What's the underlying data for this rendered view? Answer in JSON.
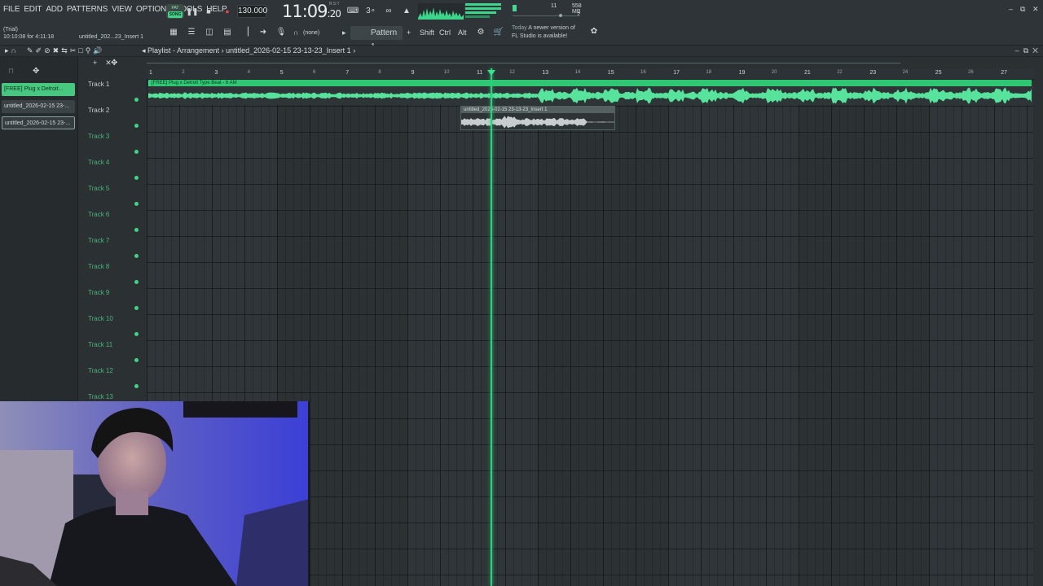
{
  "menu": [
    "FILE",
    "EDIT",
    "ADD",
    "PATTERNS",
    "VIEW",
    "OPTIONS",
    "TOOLS",
    "HELP"
  ],
  "status": {
    "trial": "(Trial)",
    "elapsed": "10:10:08 for 4:11:18",
    "project": "untitled_202...23_Insert 1"
  },
  "transport": {
    "mode": "SONG",
    "mode_top": "PAT",
    "bpm": "130.000",
    "time_main": "11:09",
    "time_sub": ":20",
    "time_label": "B:S:T"
  },
  "cpu": {
    "mem": "558 MB",
    "voices": "11",
    "poly": "2"
  },
  "toolbar": {
    "none_label": "(none)",
    "pattern": "Pattern 1",
    "shift": "Shift",
    "ctrl": "Ctrl",
    "alt": "Alt"
  },
  "news": {
    "line1": "A newer version of",
    "line2": "FL Studio is available!",
    "day": "Today"
  },
  "playlist": {
    "title": "Playlist - Arrangement",
    "breadcrumb": "untitled_2026-02-15 23-13-23_Insert 1"
  },
  "patterns": [
    "[FREE] Plug x Detroit...",
    "untitled_2026-02-15 23-...",
    "untitled_2026-02-15 23-..."
  ],
  "tracks": [
    "Track 1",
    "Track 2",
    "Track 3",
    "Track 4",
    "Track 5",
    "Track 6",
    "Track 7",
    "Track 8",
    "Track 9",
    "Track 10",
    "Track 11",
    "Track 12",
    "Track 13"
  ],
  "ruler": [
    "1",
    "2",
    "3",
    "4",
    "5",
    "6",
    "7",
    "8",
    "9",
    "10",
    "11",
    "12",
    "13",
    "14",
    "15",
    "16",
    "17",
    "18",
    "19",
    "20",
    "21",
    "22",
    "23",
    "24",
    "25",
    "26",
    "27"
  ],
  "clips": {
    "clip1_title": "[FREE] Plug x Detroit Type Beat - 6 AM",
    "clip2_title": "untitled_2026-02-15 23-13-23_Insert 1"
  },
  "colors": {
    "accent": "#3ad483",
    "background": "#2f3538"
  }
}
